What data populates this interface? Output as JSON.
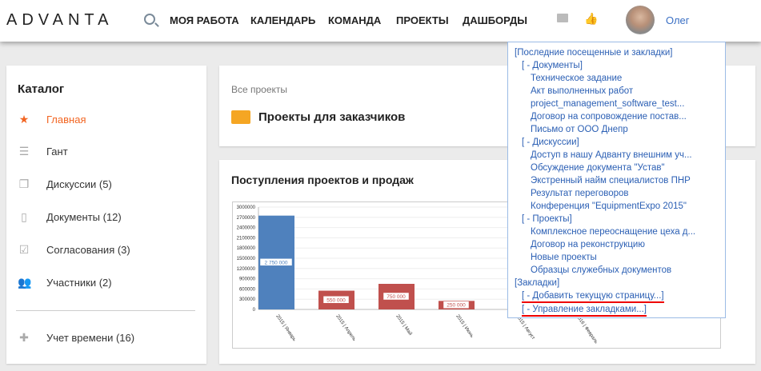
{
  "header": {
    "logo": "ADVANTA",
    "nav": [
      "МОЯ РАБОТА",
      "КАЛЕНДАРЬ",
      "КОМАНДА",
      "ПРОЕКТЫ",
      "ДАШБОРДЫ"
    ],
    "user": "Олег"
  },
  "sidebar": {
    "title": "Каталог",
    "items": [
      {
        "label": "Главная",
        "icon": "star-icon"
      },
      {
        "label": "Гант",
        "icon": "gantt-icon"
      },
      {
        "label": "Дискуссии (5)",
        "icon": "discussion-icon"
      },
      {
        "label": "Документы (12)",
        "icon": "document-icon"
      },
      {
        "label": "Согласования (3)",
        "icon": "approval-icon"
      },
      {
        "label": "Участники (2)",
        "icon": "people-icon"
      }
    ],
    "time": "Учет времени (16)"
  },
  "projects": {
    "breadcrumb": "Все проекты",
    "title": "Проекты для заказчиков"
  },
  "chart_card": {
    "title": "Поступления проектов и продаж"
  },
  "popup": {
    "header": "[Последние посещенные и закладки]",
    "documents": "[ - Документы]",
    "doc_items": [
      "Техническое задание",
      "Акт выполненных работ",
      "project_management_software_test...",
      "Договор на сопровождение постав...",
      "Письмо от ООО Днепр"
    ],
    "discussions": "[ - Дискуссии]",
    "disc_items": [
      "Доступ в нашу Адванту внешним уч...",
      "Обсуждение документа \"Устав\"",
      "Экстренный найм специалистов ПНР",
      "Результат переговоров",
      "Конференция \"EquipmentExpo 2015\""
    ],
    "projects": "[ - Проекты]",
    "proj_items": [
      "Комплексное переоснащение цеха д...",
      "Договор на реконструкцию",
      "Новые проекты",
      "Образцы служебных документов"
    ],
    "bookmarks": "[Закладки]",
    "add": "[ - Добавить текущую страницу...]",
    "manage": "[ - Управление закладками...]"
  },
  "chart_data": {
    "type": "bar",
    "categories": [
      "2015 | Январь",
      "2015 | Апрель",
      "2015 | Май",
      "2015 | Июнь",
      "2015 | Август",
      "2016 | Февраль"
    ],
    "values": [
      2750000,
      550000,
      750000,
      250000,
      null,
      null
    ],
    "data_labels": [
      "2 750 000",
      "550 000",
      "750 000",
      "250 000"
    ],
    "colors": [
      "#4f81bd",
      "#c0504d",
      "#c0504d",
      "#c0504d",
      "#c0504d",
      "#c0504d"
    ],
    "yticks": [
      "0",
      "300000",
      "600000",
      "900000",
      "1200000",
      "1500000",
      "1800000",
      "2100000",
      "2400000",
      "2700000",
      "3000000"
    ],
    "ylim": [
      0,
      3000000
    ],
    "grid": true
  }
}
